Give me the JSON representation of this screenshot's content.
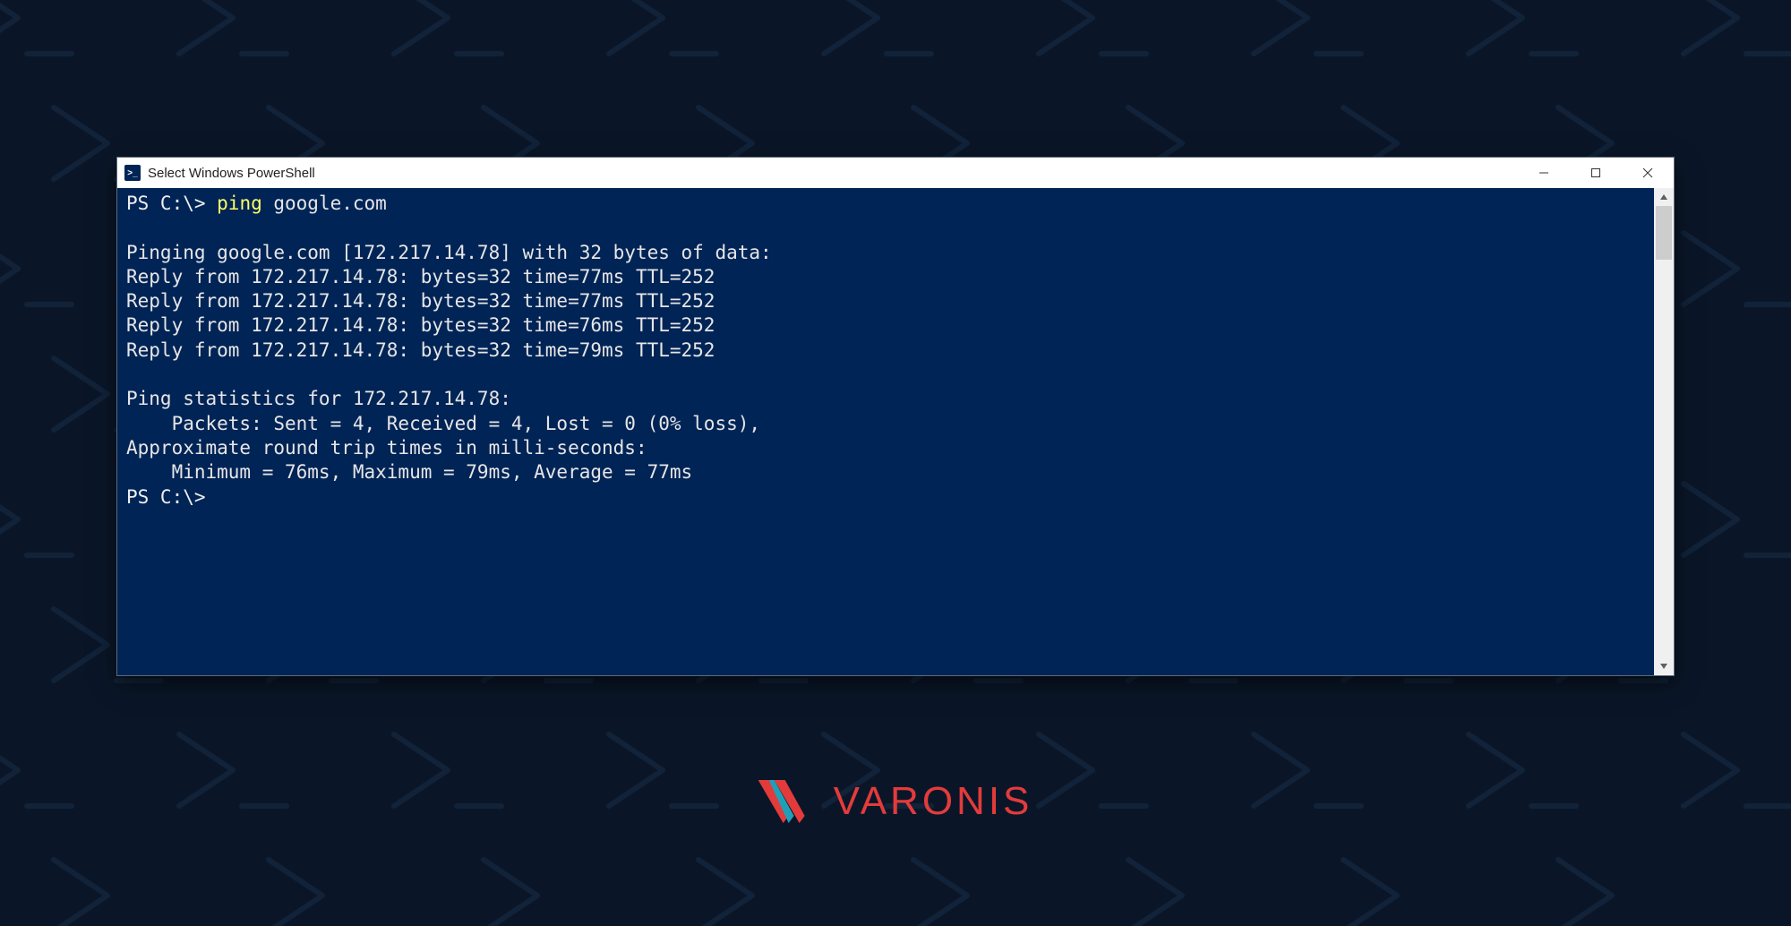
{
  "window": {
    "title": "Select Windows PowerShell",
    "icon_name": "powershell-icon"
  },
  "terminal": {
    "prompt1_prefix": "PS C:\\> ",
    "command_highlight": "ping",
    "command_rest": " google.com",
    "lines": [
      "",
      "Pinging google.com [172.217.14.78] with 32 bytes of data:",
      "Reply from 172.217.14.78: bytes=32 time=77ms TTL=252",
      "Reply from 172.217.14.78: bytes=32 time=77ms TTL=252",
      "Reply from 172.217.14.78: bytes=32 time=76ms TTL=252",
      "Reply from 172.217.14.78: bytes=32 time=79ms TTL=252",
      "",
      "Ping statistics for 172.217.14.78:",
      "    Packets: Sent = 4, Received = 4, Lost = 0 (0% loss),",
      "Approximate round trip times in milli-seconds:",
      "    Minimum = 76ms, Maximum = 79ms, Average = 77ms"
    ],
    "prompt2": "PS C:\\>"
  },
  "brand": {
    "name": "VARONIS",
    "primary_color": "#e33b3b",
    "accent_color": "#1fa0b8"
  }
}
